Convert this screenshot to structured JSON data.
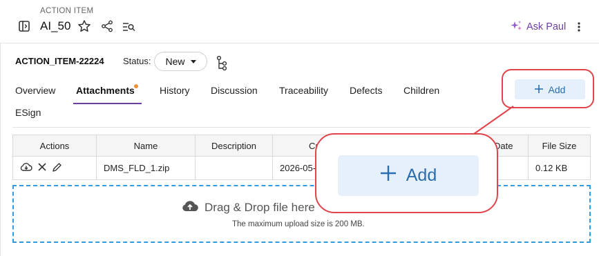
{
  "header": {
    "overline": "ACTION ITEM",
    "title": "AI_50",
    "ask_label": "Ask Paul",
    "icons": [
      "sidebar-toggle-icon",
      "star-icon",
      "share-icon",
      "list-search-icon",
      "sparkle-icon",
      "more-vertical-icon"
    ]
  },
  "item": {
    "id": "ACTION_ITEM-22224",
    "status_label": "Status:",
    "status_value": "New"
  },
  "tabs": [
    {
      "label": "Overview"
    },
    {
      "label": "Attachments",
      "active": true
    },
    {
      "label": "History"
    },
    {
      "label": "Discussion"
    },
    {
      "label": "Traceability"
    },
    {
      "label": "Defects"
    },
    {
      "label": "Children"
    },
    {
      "label": "ESign"
    }
  ],
  "add_button": {
    "label": "Add",
    "icon": "plus-icon"
  },
  "table": {
    "columns": [
      "Actions",
      "Name",
      "Description",
      "Cr",
      "Date",
      "File Size"
    ],
    "rows": [
      {
        "name": "DMS_FLD_1.zip",
        "description": "",
        "created": "2026-05-",
        "date": "",
        "size": "0.12 KB"
      }
    ]
  },
  "dropzone": {
    "text": "Drag & Drop file here",
    "sub": "The maximum upload size is 200 MB."
  },
  "callout": {
    "label": "Add",
    "color": "#e0434b"
  },
  "colors": {
    "accent": "#6b3fa0",
    "link": "#2a6cb0",
    "tab_dot": "#f0923a",
    "drop_border": "#2f9be0"
  }
}
